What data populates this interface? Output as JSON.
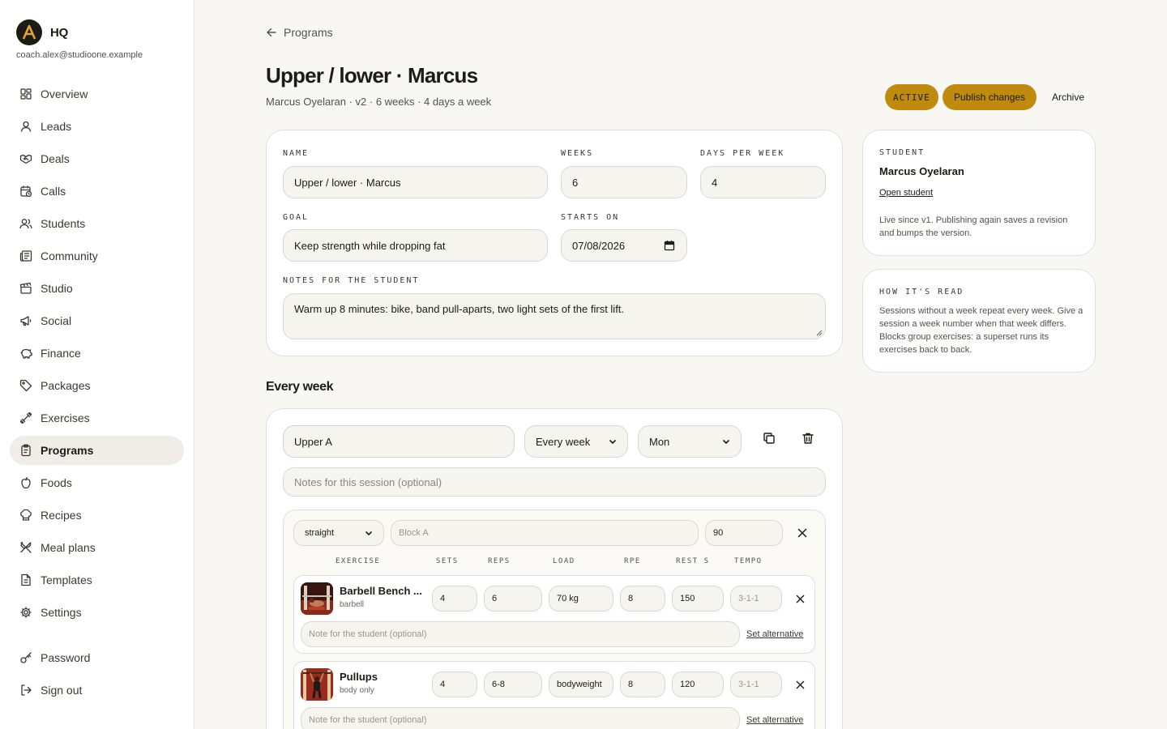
{
  "brand": {
    "name": "HQ",
    "logo_letter": "A",
    "email": "coach.alex@studioone.example"
  },
  "nav": {
    "items": [
      {
        "label": "Overview",
        "icon": "grid-icon"
      },
      {
        "label": "Leads",
        "icon": "user-icon"
      },
      {
        "label": "Deals",
        "icon": "handshake-icon"
      },
      {
        "label": "Calls",
        "icon": "calendar-clock-icon"
      },
      {
        "label": "Students",
        "icon": "users-icon"
      },
      {
        "label": "Community",
        "icon": "newspaper-icon"
      },
      {
        "label": "Studio",
        "icon": "clapperboard-icon"
      },
      {
        "label": "Social",
        "icon": "megaphone-icon"
      },
      {
        "label": "Finance",
        "icon": "piggy-bank-icon"
      },
      {
        "label": "Packages",
        "icon": "tag-icon"
      },
      {
        "label": "Exercises",
        "icon": "dumbbell-icon"
      },
      {
        "label": "Programs",
        "icon": "clipboard-icon",
        "active": true
      },
      {
        "label": "Foods",
        "icon": "apple-icon"
      },
      {
        "label": "Recipes",
        "icon": "chef-hat-icon"
      },
      {
        "label": "Meal plans",
        "icon": "utensils-icon"
      },
      {
        "label": "Templates",
        "icon": "file-text-icon"
      },
      {
        "label": "Settings",
        "icon": "gear-icon"
      }
    ],
    "bottom": [
      {
        "label": "Password",
        "icon": "key-icon"
      },
      {
        "label": "Sign out",
        "icon": "log-out-icon"
      }
    ]
  },
  "header": {
    "back_label": "Programs",
    "title": "Upper / lower · Marcus",
    "subtitle": "Marcus Oyelaran · v2 · 6 weeks · 4 days a week",
    "status": "ACTIVE",
    "publish_label": "Publish changes",
    "archive_label": "Archive"
  },
  "form": {
    "name_label": "NAME",
    "name_value": "Upper / lower · Marcus",
    "weeks_label": "WEEKS",
    "weeks_value": "6",
    "days_label": "DAYS PER WEEK",
    "days_value": "4",
    "goal_label": "GOAL",
    "goal_value": "Keep strength while dropping fat",
    "starts_label": "STARTS ON",
    "starts_value": "07/08/2026",
    "notes_label": "NOTES FOR THE STUDENT",
    "notes_value": "Warm up 8 minutes: bike, band pull-aparts, two light sets of the first lift."
  },
  "section": {
    "title": "Every week"
  },
  "session": {
    "name": "Upper A",
    "repeat": "Every week",
    "day": "Mon",
    "notes_placeholder": "Notes for this session (optional)",
    "block": {
      "type": "straight",
      "name_placeholder": "Block A",
      "rest": "90",
      "columns": [
        "EXERCISE",
        "SETS",
        "REPS",
        "LOAD",
        "RPE",
        "REST S",
        "TEMPO"
      ],
      "exercises": [
        {
          "name": "Barbell Bench ...",
          "equipment": "barbell",
          "sets": "4",
          "reps": "6",
          "load": "70 kg",
          "rpe": "8",
          "rest": "150",
          "tempo_placeholder": "3-1-1",
          "note_placeholder": "Note for the student (optional)",
          "alt_label": "Set alternative"
        },
        {
          "name": "Pullups",
          "equipment": "body only",
          "sets": "4",
          "reps": "6-8",
          "load": "bodyweight",
          "rpe": "8",
          "rest": "120",
          "tempo_placeholder": "3-1-1",
          "note_placeholder": "Note for the student (optional)",
          "alt_label": "Set alternative"
        }
      ]
    }
  },
  "student_card": {
    "title": "STUDENT",
    "name": "Marcus Oyelaran",
    "link": "Open student",
    "text": "Live since v1. Publishing again saves a revision and bumps the version."
  },
  "help_card": {
    "title": "HOW IT'S READ",
    "text": "Sessions without a week repeat every week. Give a session a week number when that week differs. Blocks group exercises: a superset runs its exercises back to back."
  },
  "colors": {
    "accent": "#c08a0d",
    "background": "#f8f7f3",
    "ink": "#1c1b18"
  }
}
